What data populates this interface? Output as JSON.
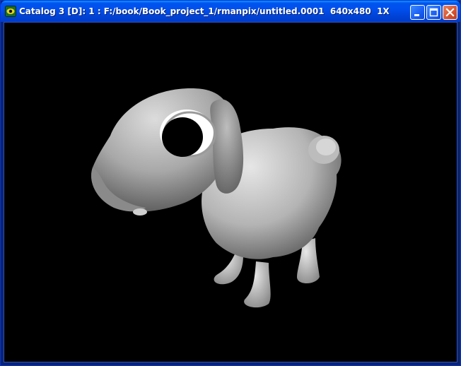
{
  "window": {
    "title": "Catalog 3 [D]: 1 : F:/book/Book_project_1/rmanpix/untitled.0001  640x480  1X",
    "buttons": {
      "minimize": "minimize",
      "maximize": "maximize",
      "close": "close"
    }
  },
  "icons": {
    "app": "render-viewer-icon",
    "minimize": "minimize-icon",
    "maximize": "maximize-icon",
    "close": "close-icon"
  },
  "colors": {
    "title_bar": "#0053ee",
    "background": "#000000",
    "close_button": "#d8522f"
  },
  "render": {
    "subject": "sheep"
  }
}
